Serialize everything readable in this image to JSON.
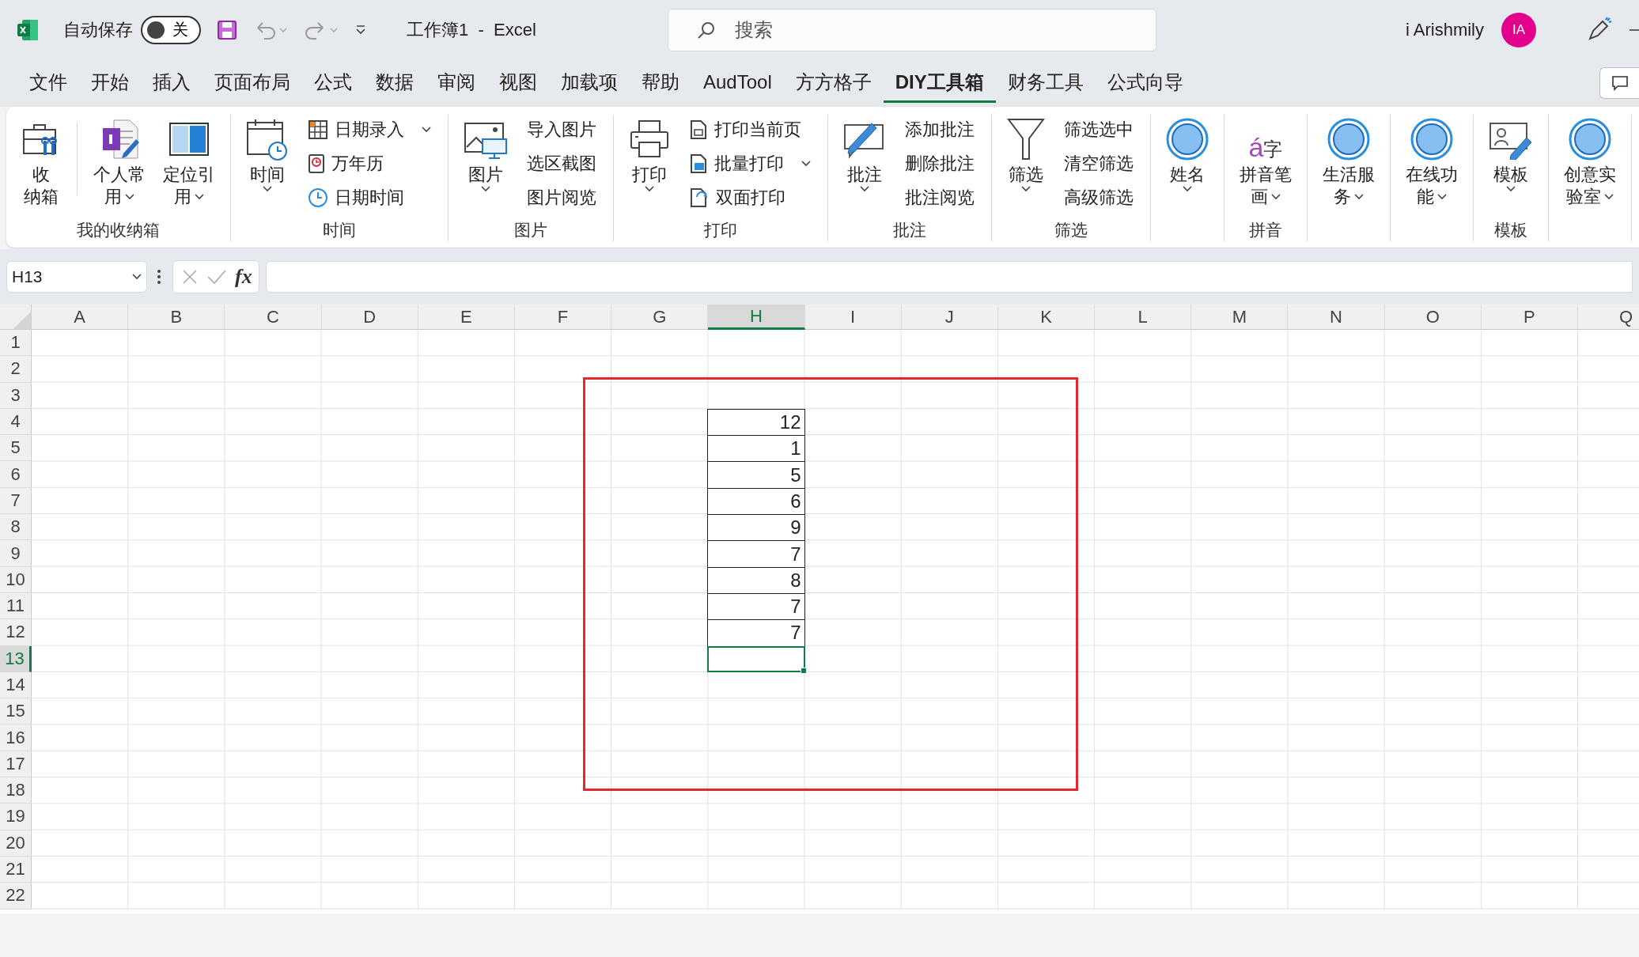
{
  "titlebar": {
    "autosave": {
      "label": "自动保存",
      "on": false,
      "state_text": "关"
    },
    "title": "工作簿1  -  Excel",
    "search": {
      "placeholder": "搜索"
    },
    "user": {
      "name": "i Arishmily",
      "initials": "IA",
      "color": "#e3008c"
    }
  },
  "tabs": [
    {
      "label": "文件",
      "selected": false
    },
    {
      "label": "开始",
      "selected": false
    },
    {
      "label": "插入",
      "selected": false
    },
    {
      "label": "页面布局",
      "selected": false
    },
    {
      "label": "公式",
      "selected": false
    },
    {
      "label": "数据",
      "selected": false
    },
    {
      "label": "审阅",
      "selected": false
    },
    {
      "label": "视图",
      "selected": false
    },
    {
      "label": "加载项",
      "selected": false
    },
    {
      "label": "帮助",
      "selected": false
    },
    {
      "label": "AudTool",
      "selected": false
    },
    {
      "label": "方方格子",
      "selected": false
    },
    {
      "label": "DIY工具箱",
      "selected": true
    },
    {
      "label": "财务工具",
      "selected": false
    },
    {
      "label": "公式向导",
      "selected": false
    }
  ],
  "ribbon": {
    "groups": [
      {
        "label": "我的收纳箱",
        "items": [
          {
            "kind": "large",
            "lines": [
              "收",
              "纳箱"
            ],
            "dropdown": false
          },
          {
            "kind": "large",
            "lines": [
              "个人常",
              "用"
            ],
            "dropdown": true
          },
          {
            "kind": "large",
            "lines": [
              "定位引",
              "用"
            ],
            "dropdown": true
          }
        ]
      },
      {
        "label": "时间",
        "items": [
          {
            "kind": "large",
            "lines": [
              "时间"
            ],
            "dropdown": true
          },
          {
            "kind": "small",
            "label": "日期录入",
            "dropdown": true
          },
          {
            "kind": "small",
            "label": "万年历",
            "dropdown": false
          },
          {
            "kind": "small",
            "label": "日期时间",
            "dropdown": false
          }
        ]
      },
      {
        "label": "图片",
        "items": [
          {
            "kind": "large",
            "lines": [
              "图片"
            ],
            "dropdown": true
          },
          {
            "kind": "text",
            "label": "导入图片",
            "dropdown": false
          },
          {
            "kind": "text",
            "label": "选区截图",
            "dropdown": false
          },
          {
            "kind": "text",
            "label": "图片阅览",
            "dropdown": false
          }
        ]
      },
      {
        "label": "打印",
        "items": [
          {
            "kind": "large",
            "lines": [
              "打印"
            ],
            "dropdown": true
          },
          {
            "kind": "small",
            "label": "打印当前页",
            "dropdown": false
          },
          {
            "kind": "small",
            "label": "批量打印",
            "dropdown": true
          },
          {
            "kind": "small",
            "label": "双面打印",
            "dropdown": false
          }
        ]
      },
      {
        "label": "批注",
        "items": [
          {
            "kind": "large",
            "lines": [
              "批注"
            ],
            "dropdown": true
          },
          {
            "kind": "text",
            "label": "添加批注",
            "dropdown": false
          },
          {
            "kind": "text",
            "label": "删除批注",
            "dropdown": false
          },
          {
            "kind": "text",
            "label": "批注阅览",
            "dropdown": false
          }
        ]
      },
      {
        "label": "筛选",
        "items": [
          {
            "kind": "large",
            "lines": [
              "筛选"
            ],
            "dropdown": true
          },
          {
            "kind": "text",
            "label": "筛选选中",
            "dropdown": false
          },
          {
            "kind": "text",
            "label": "清空筛选",
            "dropdown": false
          },
          {
            "kind": "text",
            "label": "高级筛选",
            "dropdown": false
          }
        ]
      },
      {
        "items": [
          {
            "kind": "large",
            "lines": [
              "姓名"
            ],
            "dropdown": true
          }
        ]
      },
      {
        "label": "拼音",
        "items": [
          {
            "kind": "large",
            "lines": [
              "拼音笔",
              "画"
            ],
            "dropdown": true,
            "icon_text": [
              "á",
              "字"
            ]
          }
        ]
      },
      {
        "items": [
          {
            "kind": "large",
            "lines": [
              "生活服",
              "务"
            ],
            "dropdown": true
          }
        ]
      },
      {
        "items": [
          {
            "kind": "large",
            "lines": [
              "在线功",
              "能"
            ],
            "dropdown": true
          }
        ]
      },
      {
        "label": "模板",
        "items": [
          {
            "kind": "large",
            "lines": [
              "模板"
            ],
            "dropdown": true
          }
        ]
      },
      {
        "items": [
          {
            "kind": "large",
            "lines": [
              "创意实",
              "验室"
            ],
            "dropdown": true
          }
        ]
      }
    ]
  },
  "formula_bar": {
    "name_box": "H13",
    "fx": "fx"
  },
  "sheet": {
    "columns": [
      {
        "label": "A",
        "selected": false
      },
      {
        "label": "B",
        "selected": false
      },
      {
        "label": "C",
        "selected": false
      },
      {
        "label": "D",
        "selected": false
      },
      {
        "label": "E",
        "selected": false
      },
      {
        "label": "F",
        "selected": false
      },
      {
        "label": "G",
        "selected": false
      },
      {
        "label": "H",
        "selected": true
      },
      {
        "label": "I",
        "selected": false
      },
      {
        "label": "J",
        "selected": false
      },
      {
        "label": "K",
        "selected": false
      },
      {
        "label": "L",
        "selected": false
      },
      {
        "label": "M",
        "selected": false
      },
      {
        "label": "N",
        "selected": false
      },
      {
        "label": "O",
        "selected": false
      },
      {
        "label": "P",
        "selected": false
      },
      {
        "label": "Q",
        "selected": false
      }
    ],
    "rows": [
      {
        "label": "1",
        "selected": false
      },
      {
        "label": "2",
        "selected": false
      },
      {
        "label": "3",
        "selected": false
      },
      {
        "label": "4",
        "selected": false
      },
      {
        "label": "5",
        "selected": false
      },
      {
        "label": "6",
        "selected": false
      },
      {
        "label": "7",
        "selected": false
      },
      {
        "label": "8",
        "selected": false
      },
      {
        "label": "9",
        "selected": false
      },
      {
        "label": "10",
        "selected": false
      },
      {
        "label": "11",
        "selected": false
      },
      {
        "label": "12",
        "selected": false
      },
      {
        "label": "13",
        "selected": true
      },
      {
        "label": "14",
        "selected": false
      },
      {
        "label": "15",
        "selected": false
      },
      {
        "label": "16",
        "selected": false
      },
      {
        "label": "17",
        "selected": false
      },
      {
        "label": "18",
        "selected": false
      },
      {
        "label": "19",
        "selected": false
      },
      {
        "label": "20",
        "selected": false
      },
      {
        "label": "21",
        "selected": false
      },
      {
        "label": "22",
        "selected": false
      }
    ],
    "data_block": {
      "values": [
        "12",
        "1",
        "5",
        "6",
        "9",
        "7",
        "8",
        "7",
        "7"
      ]
    },
    "highlight_frame": true
  }
}
